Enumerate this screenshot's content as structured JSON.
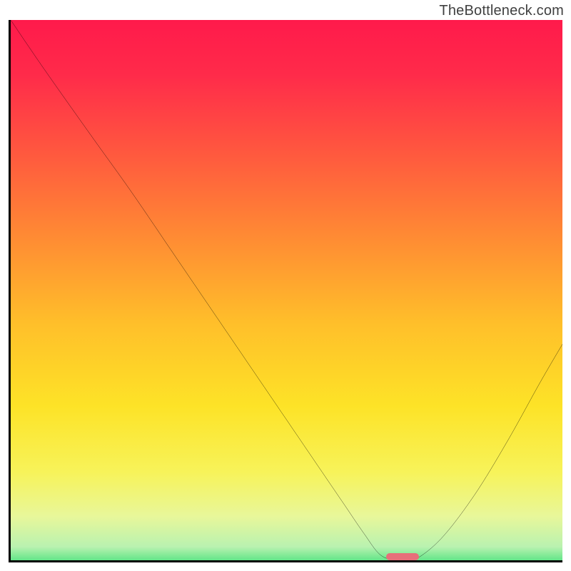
{
  "watermark": "TheBottleneck.com",
  "chart_data": {
    "type": "line",
    "title": "",
    "xlabel": "",
    "ylabel": "",
    "xlim": [
      0,
      100
    ],
    "ylim": [
      0,
      100
    ],
    "grid": false,
    "series": [
      {
        "name": "bottleneck-curve",
        "x": [
          0,
          6,
          15,
          22,
          30,
          38,
          46,
          54,
          60,
          64,
          67,
          70,
          73,
          78,
          84,
          90,
          96,
          100
        ],
        "values": [
          100,
          91,
          78,
          68,
          56,
          44,
          32,
          20,
          11,
          5,
          1,
          0,
          0,
          4,
          12,
          22,
          33,
          40
        ]
      }
    ],
    "meta": {
      "gradient_stops": [
        {
          "pos": 0.0,
          "color": "#ff1a4b"
        },
        {
          "pos": 0.1,
          "color": "#ff2b4a"
        },
        {
          "pos": 0.25,
          "color": "#ff5b3e"
        },
        {
          "pos": 0.4,
          "color": "#ff8d33"
        },
        {
          "pos": 0.55,
          "color": "#ffbf2a"
        },
        {
          "pos": 0.7,
          "color": "#fde327"
        },
        {
          "pos": 0.82,
          "color": "#f7f35a"
        },
        {
          "pos": 0.9,
          "color": "#e8f79a"
        },
        {
          "pos": 0.955,
          "color": "#b9f2b0"
        },
        {
          "pos": 0.985,
          "color": "#4fe27f"
        },
        {
          "pos": 1.0,
          "color": "#19c24e"
        }
      ],
      "marker": {
        "x0": 68,
        "x1": 74,
        "y": 0,
        "color": "#e76f7a"
      }
    }
  }
}
